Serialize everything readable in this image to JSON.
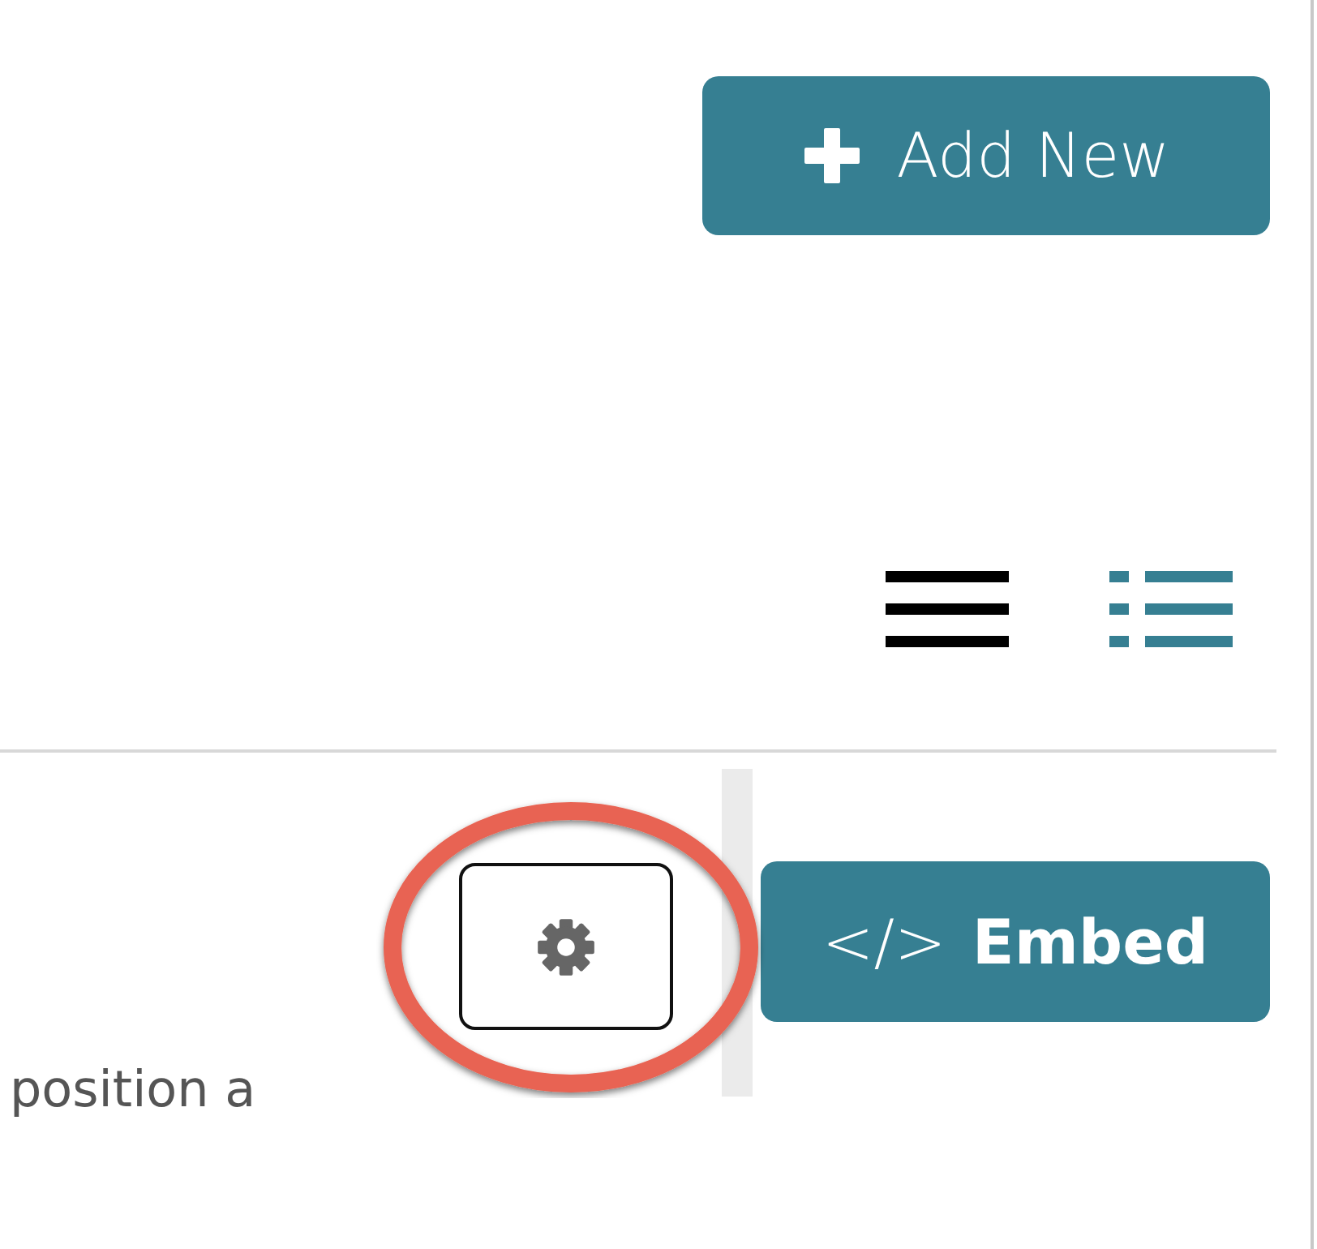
{
  "add_button": {
    "label": "Add New"
  },
  "views": [
    {
      "kind": "lines",
      "selected": false
    },
    {
      "kind": "list",
      "selected": true
    }
  ],
  "item": {
    "description": "position a",
    "settings_highlighted": true
  },
  "embed_button": {
    "glyph": "</>",
    "label": "Embed"
  }
}
